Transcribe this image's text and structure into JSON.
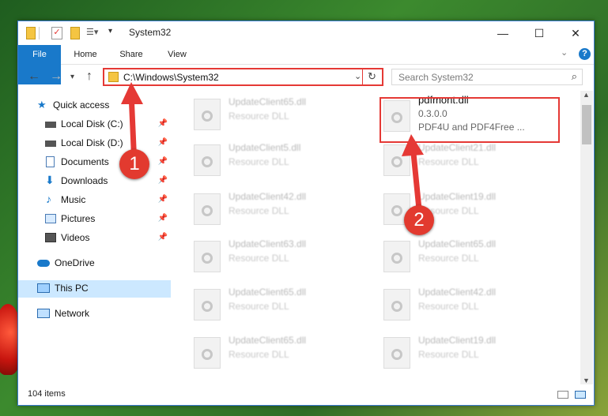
{
  "window": {
    "title": "System32"
  },
  "ribbon": {
    "tabs": [
      "File",
      "Home",
      "Share",
      "View"
    ]
  },
  "address": {
    "path": "C:\\Windows\\System32"
  },
  "search": {
    "placeholder": "Search System32"
  },
  "sidebar": {
    "items": [
      {
        "label": "Quick access",
        "icon": "star-icon",
        "pinned": false
      },
      {
        "label": "Local Disk (C:)",
        "icon": "drive-icon",
        "pinned": true
      },
      {
        "label": "Local Disk (D:)",
        "icon": "drive-icon",
        "pinned": true
      },
      {
        "label": "Documents",
        "icon": "document-icon",
        "pinned": true
      },
      {
        "label": "Downloads",
        "icon": "download-icon",
        "pinned": true
      },
      {
        "label": "Music",
        "icon": "music-icon",
        "pinned": true
      },
      {
        "label": "Pictures",
        "icon": "picture-icon",
        "pinned": true
      },
      {
        "label": "Videos",
        "icon": "video-icon",
        "pinned": true
      },
      {
        "label": "OneDrive",
        "icon": "cloud-icon",
        "pinned": false
      },
      {
        "label": "This PC",
        "icon": "computer-icon",
        "pinned": false
      },
      {
        "label": "Network",
        "icon": "network-icon",
        "pinned": false
      }
    ]
  },
  "files": {
    "left": [
      {
        "name": "UpdateClient65.dll",
        "desc": "Resource DLL"
      },
      {
        "name": "UpdateClient5.dll",
        "desc": "Resource DLL"
      },
      {
        "name": "UpdateClient42.dll",
        "desc": "Resource DLL"
      },
      {
        "name": "UpdateClient63.dll",
        "desc": "Resource DLL"
      },
      {
        "name": "UpdateClient65.dll",
        "desc": "Resource DLL"
      },
      {
        "name": "UpdateClient65.dll",
        "desc": "Resource DLL"
      }
    ],
    "right": [
      {
        "name": "pdfmont.dll",
        "version": "0.3.0.0",
        "desc": "PDF4U and PDF4Free ..."
      },
      {
        "name": "UpdateClient21.dll",
        "desc": "Resource DLL"
      },
      {
        "name": "UpdateClient19.dll",
        "desc": "Resource DLL"
      },
      {
        "name": "UpdateClient65.dll",
        "desc": "Resource DLL"
      },
      {
        "name": "UpdateClient42.dll",
        "desc": "Resource DLL"
      },
      {
        "name": "UpdateClient19.dll",
        "desc": "Resource DLL"
      }
    ]
  },
  "status": {
    "count": "104 items"
  },
  "markers": [
    "1",
    "2"
  ],
  "colors": {
    "accent": "#1979ca",
    "annotation": "#e53935"
  }
}
